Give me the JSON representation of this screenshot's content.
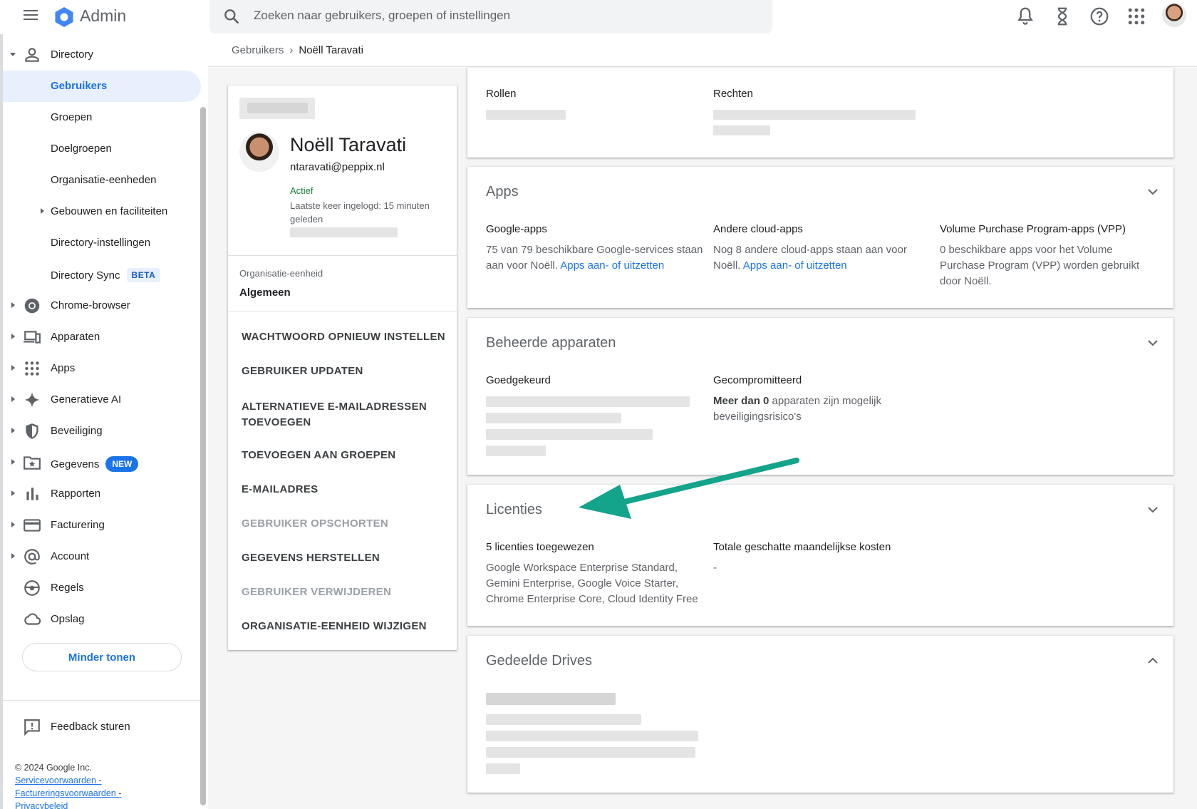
{
  "header": {
    "app_title": "Admin",
    "search_placeholder": "Zoeken naar gebruikers, groepen of instellingen"
  },
  "sidebar": {
    "items": [
      {
        "label": "Directory"
      },
      {
        "label": "Gebruikers"
      },
      {
        "label": "Groepen"
      },
      {
        "label": "Doelgroepen"
      },
      {
        "label": "Organisatie-eenheden"
      },
      {
        "label": "Gebouwen en faciliteiten"
      },
      {
        "label": "Directory-instellingen"
      },
      {
        "label": "Directory Sync",
        "badge": "BETA"
      },
      {
        "label": "Chrome-browser"
      },
      {
        "label": "Apparaten"
      },
      {
        "label": "Apps"
      },
      {
        "label": "Generatieve AI"
      },
      {
        "label": "Beveiliging"
      },
      {
        "label": "Gegevens",
        "badge": "NEW"
      },
      {
        "label": "Rapporten"
      },
      {
        "label": "Facturering"
      },
      {
        "label": "Account"
      },
      {
        "label": "Regels"
      },
      {
        "label": "Opslag"
      }
    ],
    "less_button": "Minder tonen",
    "feedback": "Feedback sturen",
    "copyright": "© 2024 Google Inc.",
    "legal": {
      "terms": "Servicevoorwaarden",
      "billing_terms": "Factureringsvoorwaarden",
      "privacy": "Privacybeleid",
      "sep": "-"
    }
  },
  "breadcrumb": {
    "parent": "Gebruikers",
    "separator": "›",
    "current": "Noëll Taravati"
  },
  "profile": {
    "name": "Noëll Taravati",
    "email": "ntaravati@peppix.nl",
    "status": "Actief",
    "last_login": "Laatste keer ingelogd: 15 minuten geleden",
    "org_unit_label": "Organisatie-eenheid",
    "org_unit_value": "Algemeen",
    "actions": [
      {
        "label": "WACHTWOORD OPNIEUW INSTELLEN",
        "enabled": true
      },
      {
        "label": "GEBRUIKER UPDATEN",
        "enabled": true
      },
      {
        "label": "ALTERNATIEVE E-MAILADRESSEN TOEVOEGEN",
        "enabled": true
      },
      {
        "label": "TOEVOEGEN AAN GROEPEN",
        "enabled": true
      },
      {
        "label": "E-MAILADRES",
        "enabled": true
      },
      {
        "label": "GEBRUIKER OPSCHORTEN",
        "enabled": false
      },
      {
        "label": "GEGEVENS HERSTELLEN",
        "enabled": true
      },
      {
        "label": "GEBRUIKER VERWIJDEREN",
        "enabled": false
      },
      {
        "label": "ORGANISATIE-EENHEID WIJZIGEN",
        "enabled": true
      }
    ]
  },
  "sections": {
    "admin_roles": {
      "roles_label": "Rollen",
      "rights_label": "Rechten"
    },
    "apps": {
      "title": "Apps",
      "google_apps_title": "Google-apps",
      "google_apps_text": "75 van 79 beschikbare Google-services staan aan voor Noëll.",
      "google_apps_link": "Apps aan- of uitzetten",
      "cloud_apps_title": "Andere cloud-apps",
      "cloud_apps_text": "Nog 8 andere cloud-apps staan aan voor Noëll.",
      "cloud_apps_link": "Apps aan- of uitzetten",
      "vpp_title": "Volume Purchase Program-apps (VPP)",
      "vpp_text": "0 beschikbare apps voor het Volume Purchase Program (VPP) worden gebruikt door Noëll."
    },
    "devices": {
      "title": "Beheerde apparaten",
      "approved_title": "Goedgekeurd",
      "compromised_title": "Gecompromitteerd",
      "compromised_bold": "Meer dan 0",
      "compromised_text": "apparaten zijn mogelijk beveiligingsrisico's"
    },
    "licenses": {
      "title": "Licenties",
      "assigned_title": "5 licenties toegewezen",
      "assigned_text": "Google Workspace Enterprise Standard, Gemini Enterprise, Google Voice Starter, Chrome Enterprise Core, Cloud Identity Free",
      "cost_title": "Totale geschatte maandelijkse kosten",
      "cost_value": "-"
    },
    "shared_drives": {
      "title": "Gedeelde Drives"
    }
  },
  "colors": {
    "accent": "#1a73e8",
    "active_bg": "#e8f0fe",
    "status_green": "#188038",
    "annotation_arrow": "#14a38b"
  }
}
